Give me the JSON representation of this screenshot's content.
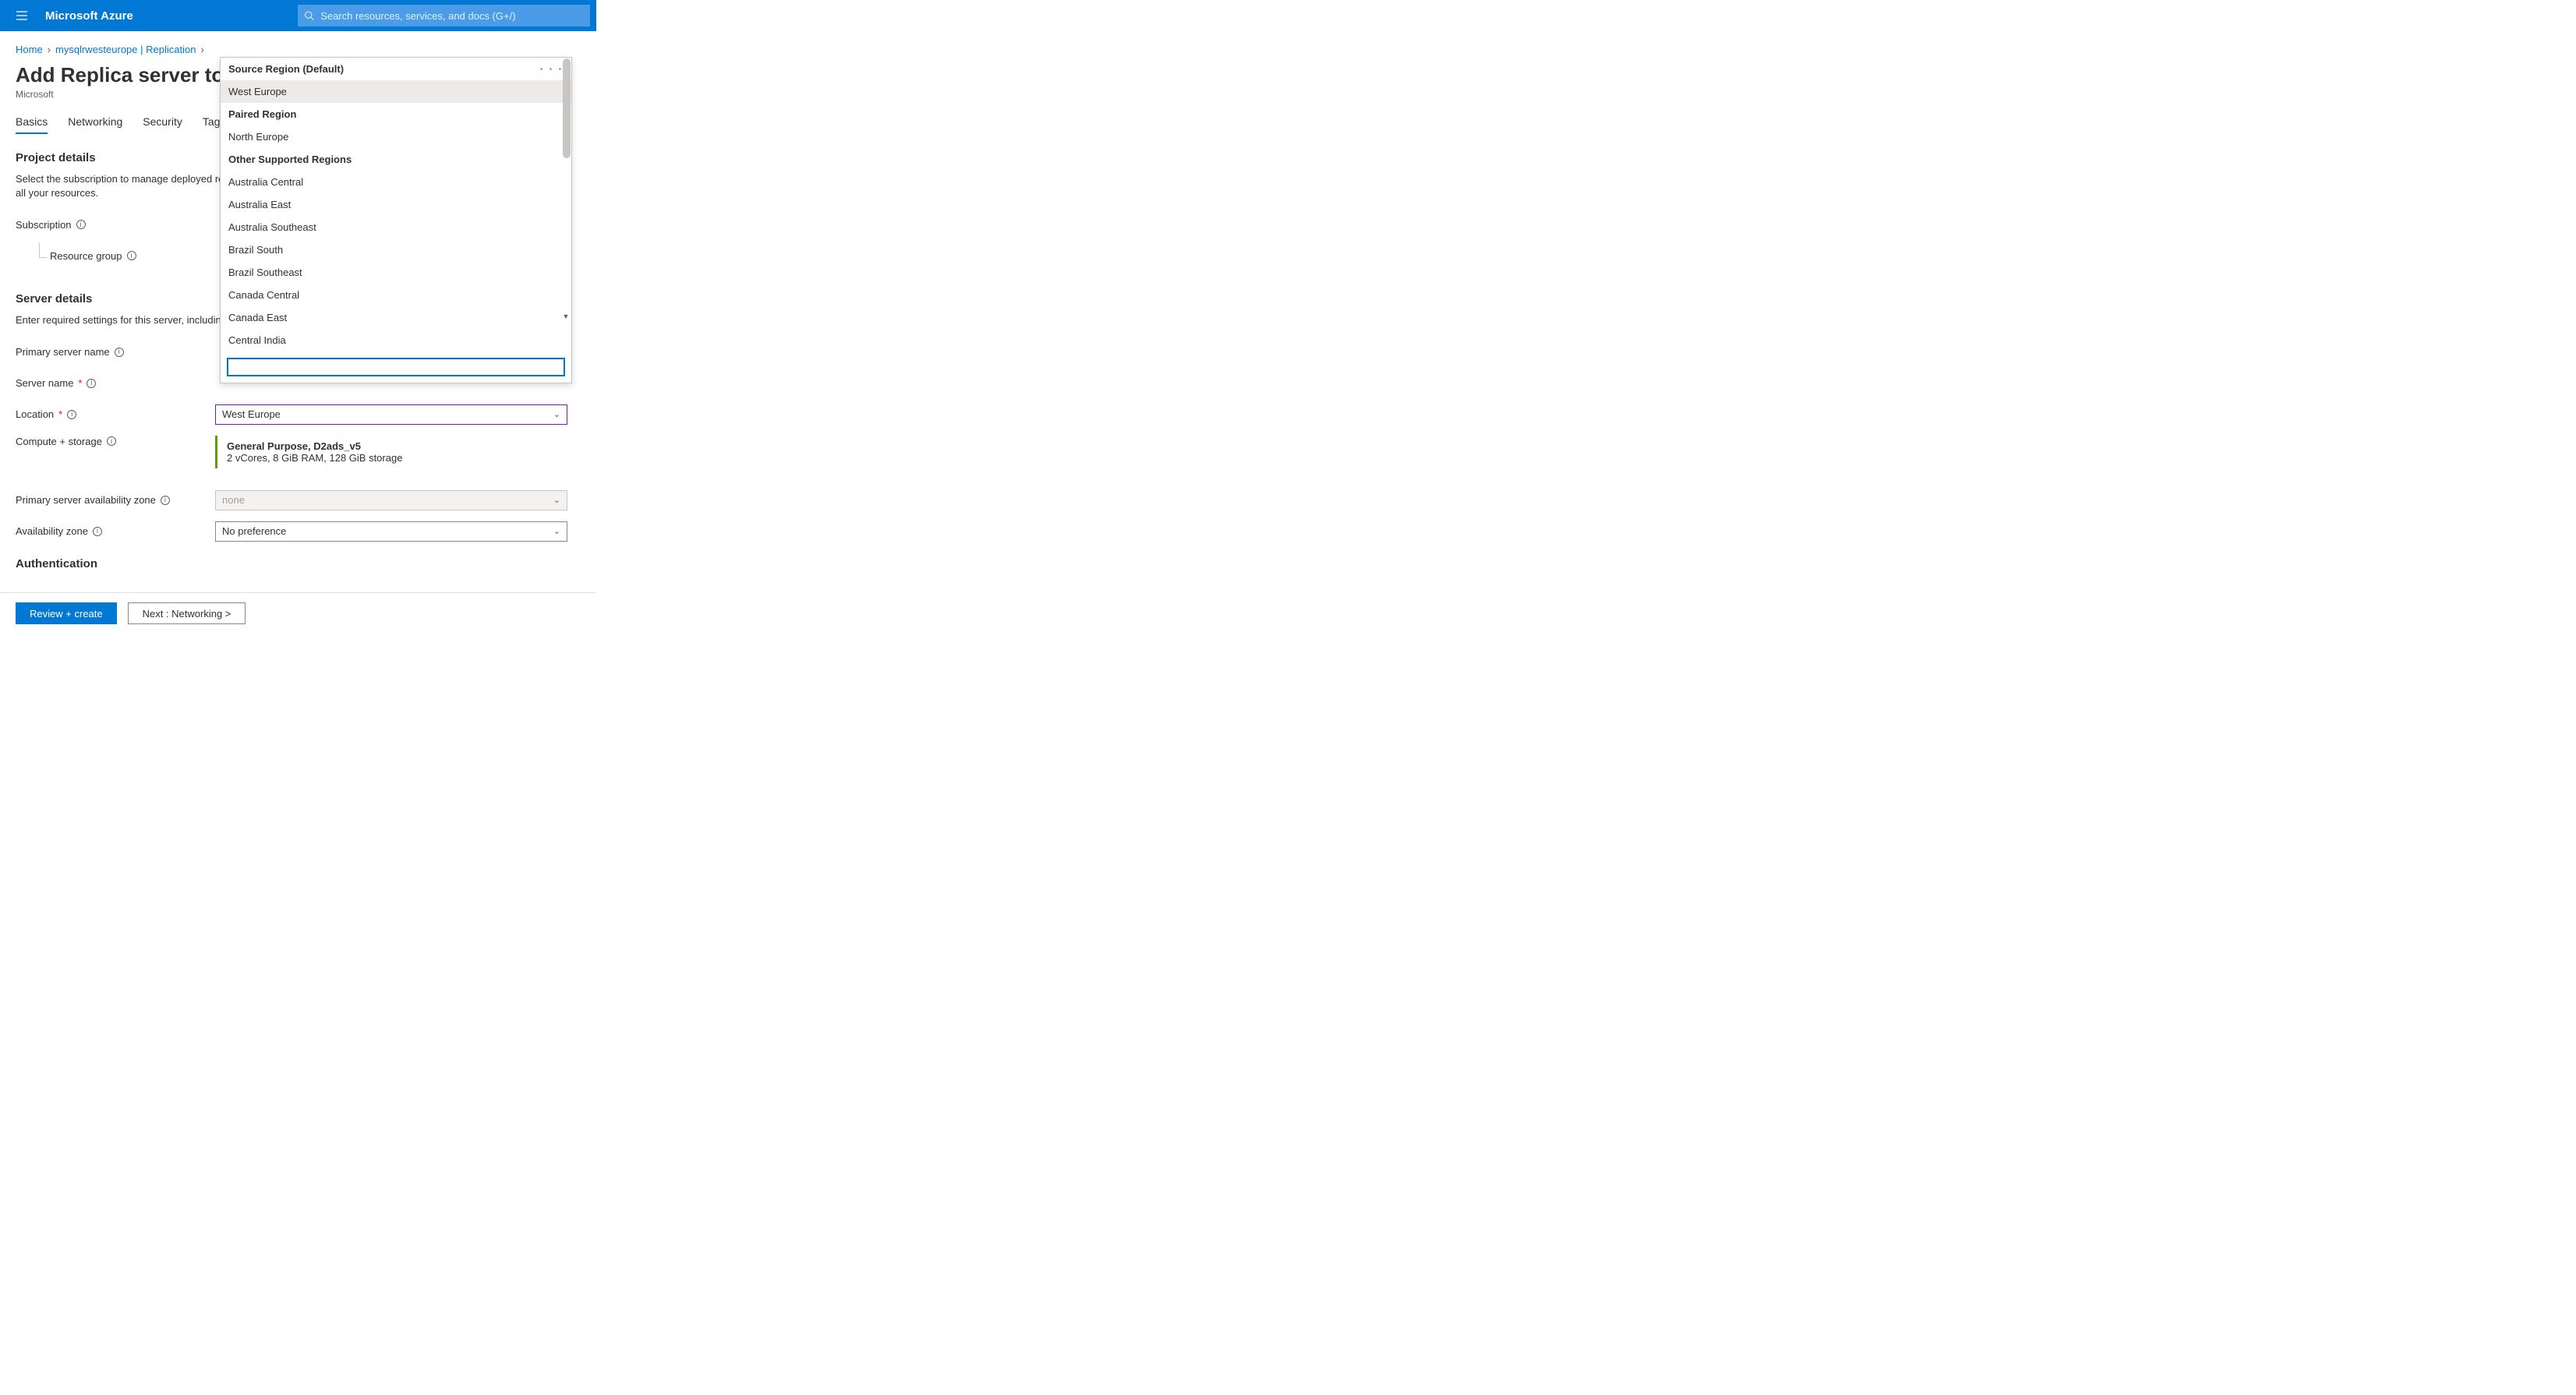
{
  "header": {
    "brand": "Microsoft Azure",
    "search_placeholder": "Search resources, services, and docs (G+/)"
  },
  "breadcrumb": {
    "home": "Home",
    "resource": "mysqlrwesteurope | Replication"
  },
  "page": {
    "title": "Add Replica server to Azure Database for MySQL",
    "subtitle": "Microsoft"
  },
  "tabs": {
    "basics": "Basics",
    "networking": "Networking",
    "security": "Security",
    "tags": "Tags"
  },
  "project": {
    "heading": "Project details",
    "desc": "Select the subscription to manage deployed resources and costs. Use resource groups like folders to organize and manage all your resources.",
    "subscription_label": "Subscription",
    "resource_group_label": "Resource group"
  },
  "server": {
    "heading": "Server details",
    "desc": "Enter required settings for this server, including picking a location and configuring the compute and storage resources.",
    "primary_name_label": "Primary server name",
    "server_name_label": "Server name",
    "location_label": "Location",
    "location_value": "West Europe",
    "compute_label": "Compute + storage",
    "compute_title": "General Purpose, D2ads_v5",
    "compute_desc": "2 vCores, 8 GiB RAM, 128 GiB storage",
    "primary_az_label": "Primary server availability zone",
    "primary_az_value": "none",
    "az_label": "Availability zone",
    "az_value": "No preference"
  },
  "auth": {
    "heading": "Authentication"
  },
  "dropdown": {
    "group1": "Source Region (Default)",
    "item1": "West Europe",
    "group2": "Paired Region",
    "item2": "North Europe",
    "group3": "Other Supported Regions",
    "opt1": "Australia Central",
    "opt2": "Australia East",
    "opt3": "Australia Southeast",
    "opt4": "Brazil South",
    "opt5": "Brazil Southeast",
    "opt6": "Canada Central",
    "opt7": "Canada East",
    "opt8": "Central India"
  },
  "footer": {
    "review": "Review + create",
    "next": "Next : Networking >"
  }
}
